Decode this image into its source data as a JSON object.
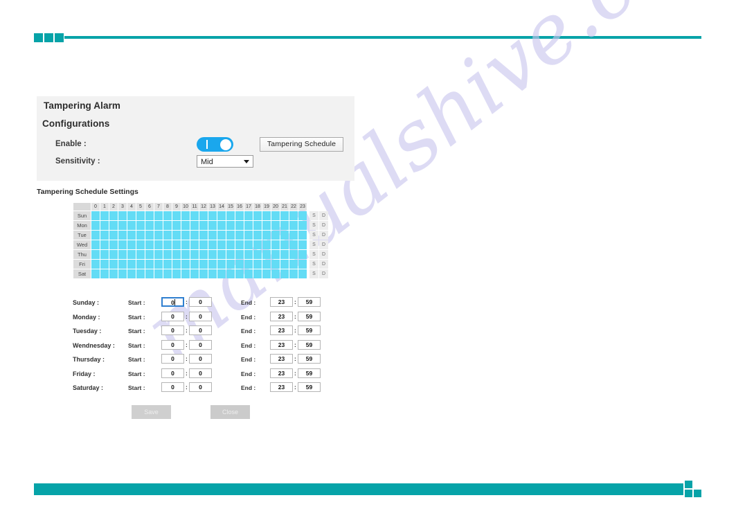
{
  "watermark": {
    "text": "manualshive.com"
  },
  "theme": {
    "accent": "#06a3a8",
    "toggle_on": "#1aa7ed",
    "grid_cell": "#63dcf5"
  },
  "panel": {
    "title": "Tampering Alarm",
    "subtitle": "Configurations",
    "enable_label": "Enable :",
    "enable_state": "on",
    "sensitivity_label": "Sensitivity :",
    "sensitivity_value": "Mid",
    "sensitivity_options": [
      "Mid"
    ],
    "schedule_button": "Tampering Schedule"
  },
  "schedule": {
    "heading": "Tampering Schedule Settings",
    "hours": [
      "0",
      "1",
      "2",
      "3",
      "4",
      "5",
      "6",
      "7",
      "8",
      "9",
      "10",
      "11",
      "12",
      "13",
      "14",
      "15",
      "16",
      "17",
      "18",
      "19",
      "20",
      "21",
      "22",
      "23"
    ],
    "days_short": [
      "Sun",
      "Mon",
      "Tue",
      "Wed",
      "Thu",
      "Fri",
      "Sat"
    ],
    "select_all_label": "S",
    "deselect_all_label": "D"
  },
  "day_rows": {
    "start_label": "Start :",
    "end_label": "End :",
    "separator": ":",
    "rows": [
      {
        "day": "Sunday :",
        "start_hour": "0",
        "start_min": "0",
        "end_hour": "23",
        "end_min": "59",
        "focused": true
      },
      {
        "day": "Monday :",
        "start_hour": "0",
        "start_min": "0",
        "end_hour": "23",
        "end_min": "59",
        "focused": false
      },
      {
        "day": "Tuesday :",
        "start_hour": "0",
        "start_min": "0",
        "end_hour": "23",
        "end_min": "59",
        "focused": false
      },
      {
        "day": "Wendnesday :",
        "start_hour": "0",
        "start_min": "0",
        "end_hour": "23",
        "end_min": "59",
        "focused": false
      },
      {
        "day": "Thursday :",
        "start_hour": "0",
        "start_min": "0",
        "end_hour": "23",
        "end_min": "59",
        "focused": false
      },
      {
        "day": "Friday :",
        "start_hour": "0",
        "start_min": "0",
        "end_hour": "23",
        "end_min": "59",
        "focused": false
      },
      {
        "day": "Saturday :",
        "start_hour": "0",
        "start_min": "0",
        "end_hour": "23",
        "end_min": "59",
        "focused": false
      }
    ]
  },
  "actions": {
    "save_label": "Save",
    "close_label": "Close"
  }
}
